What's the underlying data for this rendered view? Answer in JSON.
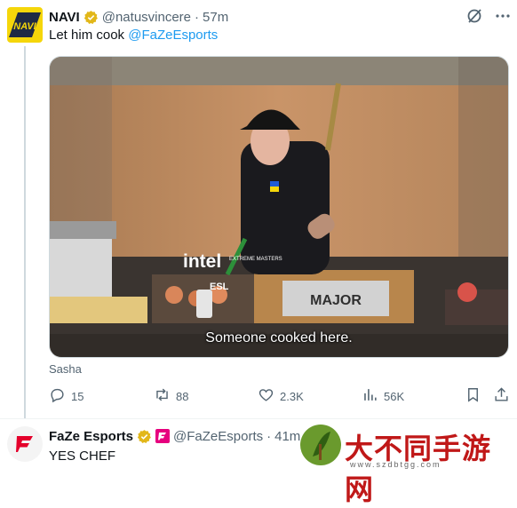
{
  "tweet": {
    "author_name": "NAVI",
    "handle": "@natusvincere",
    "separator": "·",
    "time": "57m",
    "text_prefix": "Let him cook ",
    "mention": "@FaZeEsports",
    "media": {
      "caption": "Someone cooked here.",
      "brand_text": "intel",
      "sub_brand": "EXTREME MASTERS",
      "esl": "ESL",
      "major": "MAJOR"
    },
    "attribution": "Sasha",
    "actions": {
      "replies": "15",
      "reposts": "88",
      "likes": "2.3K",
      "views": "56K"
    }
  },
  "reply": {
    "author_name": "FaZe Esports",
    "handle": "@FaZeEsports",
    "separator": "·",
    "time": "41m",
    "text": "YES CHEF"
  },
  "watermark": {
    "text": "大不同手游网",
    "url": "www.szdbtgg.com"
  },
  "colors": {
    "accent": "#1d9bf0",
    "muted": "#536471",
    "verified_gold": "#e2b719",
    "navi_yellow": "#f5d60a",
    "faze_red": "#e4002b",
    "affiliate_pink": "#e6007e"
  }
}
